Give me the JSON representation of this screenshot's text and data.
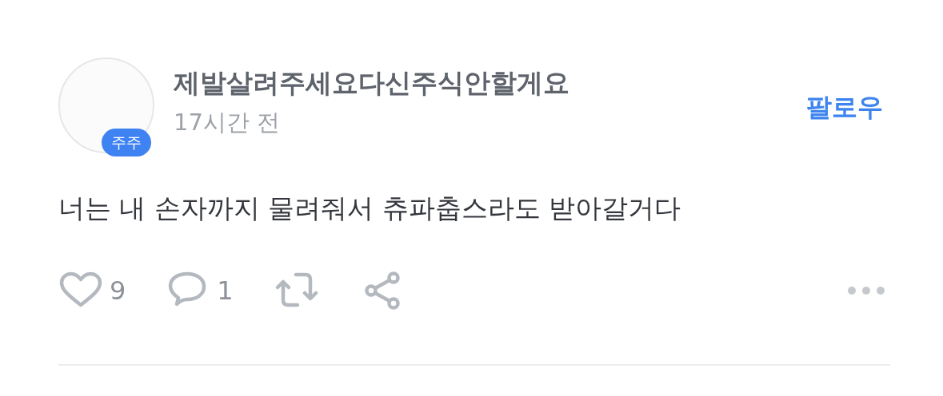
{
  "author": {
    "name": "제발살려주세요다신주식안할게요",
    "badge": "주주",
    "time": "17시간 전"
  },
  "follow_button": {
    "label": "팔로우"
  },
  "post": {
    "text": "너는 내 손자까지 물려줘서 츄파춥스라도 받아갈거다"
  },
  "actions": {
    "like": {
      "count": "9",
      "liked": false
    },
    "comment": {
      "count": "1"
    }
  }
}
